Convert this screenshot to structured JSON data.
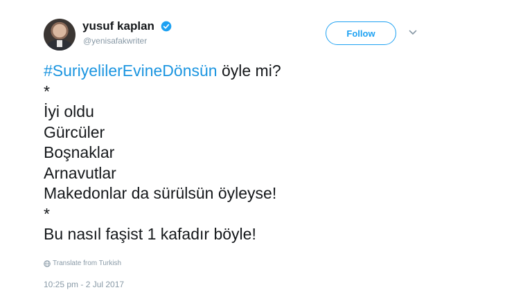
{
  "author": {
    "display_name": "yusuf kaplan",
    "handle": "@yenisafakwriter",
    "verified": true
  },
  "follow_button": {
    "label": "Follow"
  },
  "tweet": {
    "hashtag": "#SuriyelilerEvineDönsün",
    "first_line_rest": " öyle mi?",
    "lines": [
      "*",
      "İyi oldu",
      "Gürcüler",
      "Boşnaklar",
      "Arnavutlar",
      "Makedonlar da sürülsün öyleyse!",
      "*",
      "Bu nasıl faşist 1 kafadır böyle!"
    ]
  },
  "translate_link": "Translate from Turkish",
  "timestamp": "10:25 pm - 2 Jul 2017",
  "colors": {
    "accent": "#1da1f2",
    "hashtag": "#1b95e0",
    "muted": "#8899a6",
    "text": "#14171a"
  },
  "icons": [
    "verified-badge-icon",
    "chevron-down-icon",
    "globe-icon"
  ]
}
